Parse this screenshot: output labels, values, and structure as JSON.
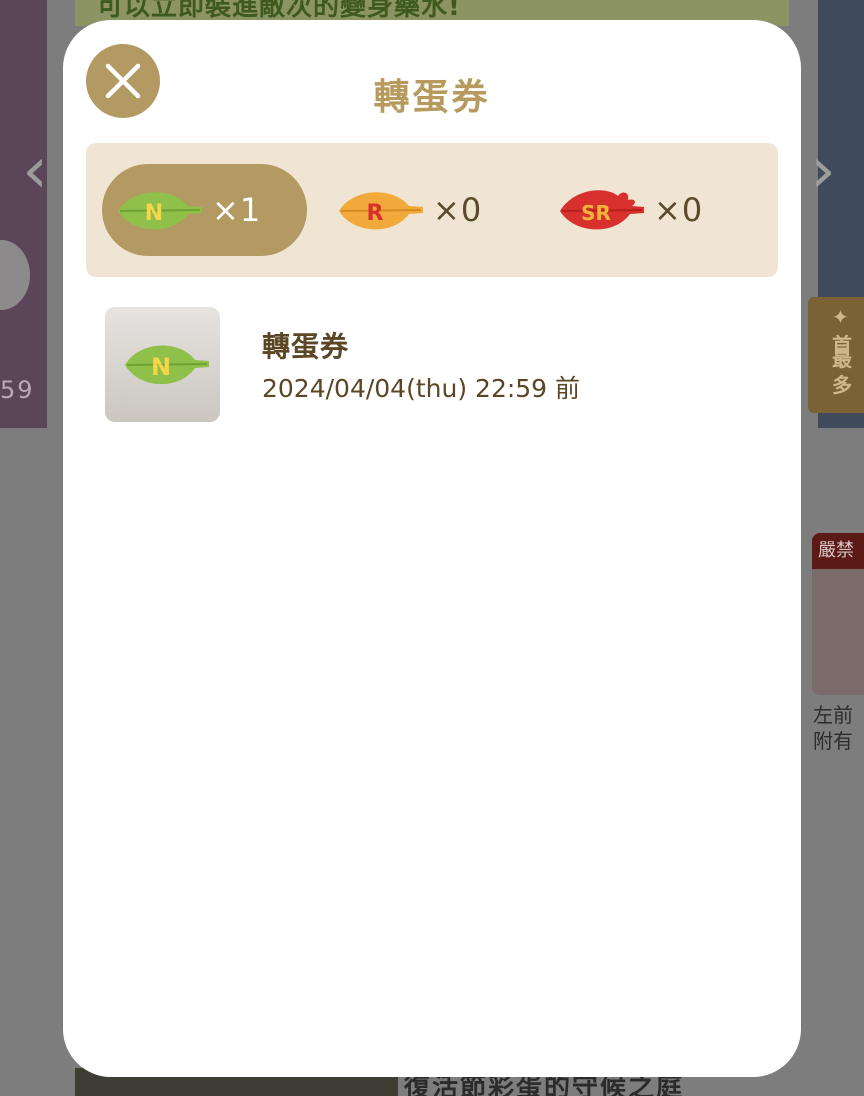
{
  "background": {
    "banner_text": "可以立即裝進敵次的變身藥水!",
    "left_card_count": "59",
    "right_tag_line1": "✦首",
    "right_tag_line2": "最",
    "right_tag_line3": "多",
    "news_label": "嚴禁",
    "news_text_line1": "左前",
    "news_text_line2": "附有",
    "bottom_title": "復活節彩蛋的守候之庭"
  },
  "modal": {
    "title": "轉蛋券",
    "tabs": [
      {
        "rarity": "N",
        "quantity": "×1",
        "active": true,
        "color": "#8fc04a"
      },
      {
        "rarity": "R",
        "quantity": "×0",
        "active": false,
        "color": "#f0a93a"
      },
      {
        "rarity": "SR",
        "quantity": "×0",
        "active": false,
        "color": "#d8302c"
      }
    ],
    "items": [
      {
        "icon": "leaf-n-icon",
        "name": "轉蛋券",
        "expiry": "2024/04/04(thu) 22:59 前"
      }
    ]
  },
  "colors": {
    "accent": "#b39a62",
    "title": "#b79a5d",
    "tab_bar_bg": "#efe5d2",
    "text": "#5b4626"
  }
}
